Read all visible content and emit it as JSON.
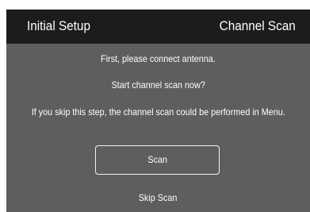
{
  "header": {
    "title": "Initial Setup",
    "step": "Channel Scan"
  },
  "body": {
    "line1": "First, please connect antenna.",
    "line2": "Start channel scan now?",
    "line3": "If you skip this step, the channel scan could be performed in Menu."
  },
  "actions": {
    "scan_label": "Scan",
    "skip_label": "Skip Scan"
  },
  "colors": {
    "header_bg": "#1c1c1c",
    "panel_bg": "#5e5e5e",
    "text": "#ffffff",
    "button_border": "#f2f2f2"
  }
}
